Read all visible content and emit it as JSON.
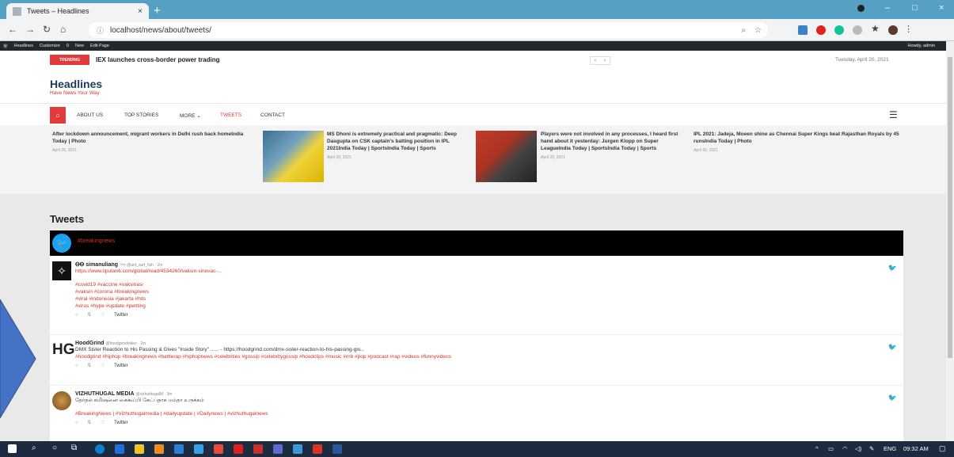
{
  "browser": {
    "tab_title": "Tweets – Headlines",
    "tab_close": "×",
    "new_tab": "+",
    "url": "localhost/news/about/tweets/",
    "win_controls": [
      "–",
      "□",
      "×"
    ]
  },
  "wp_admin": {
    "items": [
      "Headlines",
      "Customize",
      "0",
      "New",
      "Edit Page"
    ],
    "greeting": "Howdy, admin"
  },
  "header": {
    "trending_label": "TRENDING",
    "trending_text": "IEX launches cross-border power trading",
    "slider_prev": "‹",
    "slider_next": "›",
    "date": "Tuesday, April 20, 2021",
    "brand": "Headlines",
    "tagline": "Have News Your Way"
  },
  "menu": {
    "items": [
      "ABOUT US",
      "TOP STORIES",
      "MORE ⌄",
      "TWEETS",
      "CONTACT"
    ]
  },
  "featured": [
    {
      "title": "After lockdown announcement, migrant workers in Delhi rush back homeIndia Today | Photo",
      "date": "April 20, 2021"
    },
    {
      "title": "MS Dhoni is extremely practical and pragmatic: Deep Dasgupta on CSK captain's batting position in IPL 2021India Today | SportsIndia Today | Sports",
      "date": "April 20, 2021"
    },
    {
      "title": "Players were not involved in any processes, I heard first hand about it yesterday: Jurgen Klopp on Super LeagueIndia Today | SportsIndia Today | Sports",
      "date": "April 20, 2021"
    },
    {
      "title": "IPL 2021: Jadeja, Moeen shine as Chennai Super Kings beat Rajasthan Royals by 45 runsIndia Today | Photo",
      "date": "April 20, 2021"
    }
  ],
  "tweets_section": {
    "title": "Tweets",
    "hashtag": "#breakingnews",
    "items": [
      {
        "name": "ꝊꝊ simanuliang",
        "handle": "ᵀᴬᵞˢ @ant_surf_fish · 2m",
        "link": "https://www.liputan6.com/global/read/4534260/vaksin-sinovac-...",
        "tags": [
          "#covid19 #vaccine #vaksinasi",
          "#vaksin #corona #breakingnews",
          "#viral #indonesia #jakarta #hits",
          "#virus #hype #update #penting"
        ],
        "source": "Twitter"
      },
      {
        "name": "HoodGrind",
        "handle": "@hoodgrindvideo · 2m",
        "text": "DMX Sister Reaction to His Passing & Gives \"Inside Story\" ...... - https://hoodgrind.com/dmx-sister-reaction-to-his-passing-giv...",
        "tags": [
          "#hoodgrind #hiphop #breakingnews #battlerap #hiphopnews #celebrities #gossip #celebritygossip #hoodclips #music #rnb #pop #podcast #rap #videos #funnyvideos"
        ],
        "source": "Twitter"
      },
      {
        "name": "VIZHUTHUGAL MEDIA",
        "handle": "@vizhuthugalM · 3m",
        "text": "தேர்தல் கமிஷனை கைகூப்பி கேட்பதாக மம்தா உருக்கம்",
        "tags": [
          "#BreakingNews | #Vizhuthugalmedia | #dailyupdate | #Dailynews | #vizhuthugalnews"
        ],
        "source": "Twitter"
      }
    ]
  },
  "taskbar": {
    "lang": "ENG",
    "time": "09:32 AM"
  }
}
